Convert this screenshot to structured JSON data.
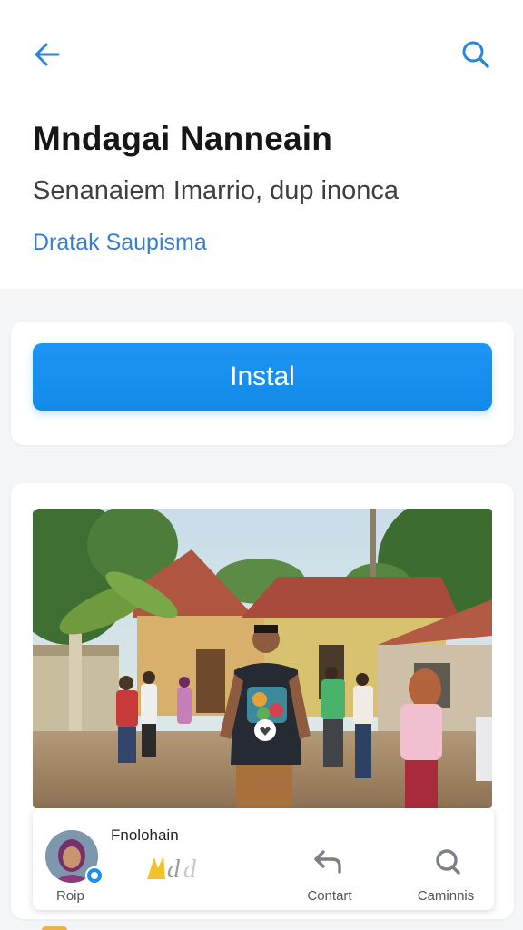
{
  "header": {
    "back_icon": "arrow-left-icon",
    "search_icon": "search-icon",
    "accent_color": "#2a86d6"
  },
  "app": {
    "title": "Mndagai Nanneain",
    "subtitle": "Senanaiem Imarrio, dup inonca",
    "developer": "Dratak Saupisma"
  },
  "install": {
    "label": "Instal",
    "color": "#1a90f2"
  },
  "post": {
    "photo_icon": "village-photo",
    "author": "Fnolohain",
    "avatar_label": "Roip",
    "contact_label": "Contart",
    "comments_label": "Caminnis",
    "contact_icon": "share-arrow-icon",
    "comments_icon": "comment-bubble-icon"
  }
}
